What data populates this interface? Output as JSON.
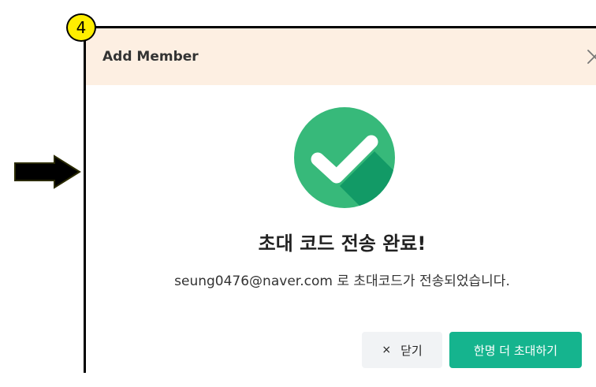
{
  "annotation": {
    "step_number": "4"
  },
  "dialog": {
    "title": "Add Member",
    "close_icon": "close-icon",
    "success_icon": "check-circle-icon",
    "headline": "초대 코드 전송 완료!",
    "message": "seung0476@naver.com 로 초대코드가 전송되었습니다.",
    "buttons": {
      "close_glyph": "×",
      "close_label": "닫기",
      "invite_more_label": "한명 더 초대하기"
    }
  },
  "colors": {
    "header_bg": "#fdefe2",
    "success_green": "#37b97a",
    "primary_button": "#15b48e",
    "secondary_button": "#f1f3f5",
    "badge_yellow": "#ffee00"
  }
}
